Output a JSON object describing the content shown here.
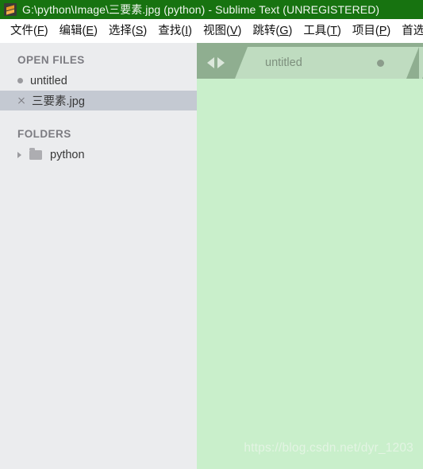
{
  "window": {
    "title": "G:\\python\\Image\\三要素.jpg (python) - Sublime Text (UNREGISTERED)",
    "app_icon": "sublime-text-icon",
    "titlebar_color": "#177310"
  },
  "menubar": {
    "items": [
      {
        "label": "文件",
        "accel": "F"
      },
      {
        "label": "编辑",
        "accel": "E"
      },
      {
        "label": "选择",
        "accel": "S"
      },
      {
        "label": "查找",
        "accel": "I"
      },
      {
        "label": "视图",
        "accel": "V"
      },
      {
        "label": "跳转",
        "accel": "G"
      },
      {
        "label": "工具",
        "accel": "T"
      },
      {
        "label": "项目",
        "accel": "P"
      },
      {
        "label": "首选",
        "accel": ""
      }
    ]
  },
  "sidebar": {
    "open_files": {
      "heading": "OPEN FILES",
      "items": [
        {
          "label": "untitled",
          "icon": "dirty-dot-icon",
          "selected": false
        },
        {
          "label": "三要素.jpg",
          "icon": "close-icon",
          "selected": true
        }
      ]
    },
    "folders": {
      "heading": "FOLDERS",
      "items": [
        {
          "label": "python",
          "icon": "folder-icon",
          "expander": "chevron-right-icon"
        }
      ]
    },
    "background_color": "#ebecee",
    "selected_color": "#c4c9d2"
  },
  "editor": {
    "tab_nav": {
      "prev": "nav-prev-icon",
      "next": "nav-next-icon"
    },
    "tabs": [
      {
        "label": "untitled",
        "dirty": true,
        "active": true
      }
    ],
    "background_color": "#c9efcb",
    "tabbar_color": "#8fae90",
    "watermark": "https://blog.csdn.net/dyr_1203"
  }
}
